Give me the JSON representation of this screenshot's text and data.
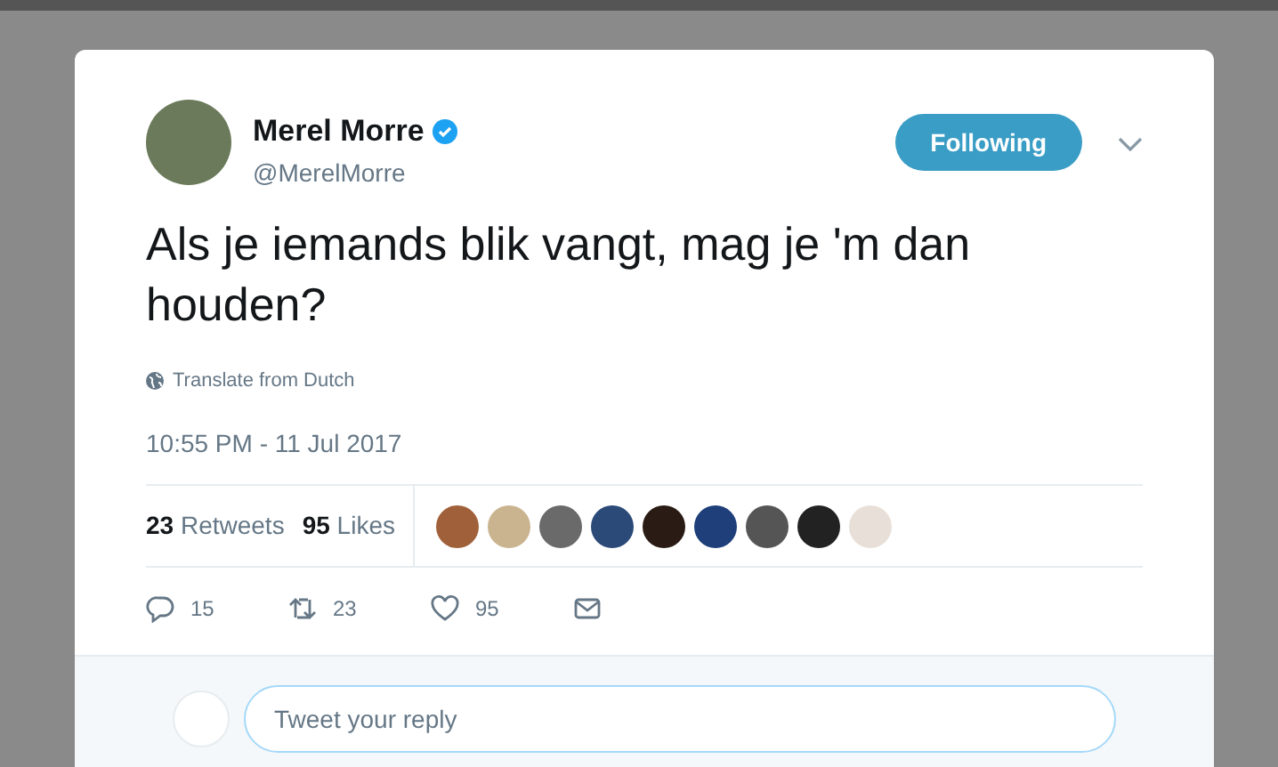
{
  "author": {
    "name": "Merel Morre",
    "handle": "@MerelMorre",
    "verified": true
  },
  "follow_button": {
    "label": "Following",
    "selected": true
  },
  "tweet": {
    "text": "Als je iemands blik vangt, mag je 'm dan houden?",
    "translate": "Translate from Dutch",
    "timestamp": "10:55 PM - 11 Jul 2017"
  },
  "stats": [
    {
      "count": "23",
      "label": "Retweets"
    },
    {
      "count": "95",
      "label": "Likes"
    }
  ],
  "actions": [
    {
      "kind": "reply",
      "count": "15"
    },
    {
      "kind": "retweet",
      "count": "23"
    },
    {
      "kind": "like",
      "count": "95"
    },
    {
      "kind": "message"
    }
  ],
  "reply_box": {
    "placeholder": "Tweet your reply"
  }
}
